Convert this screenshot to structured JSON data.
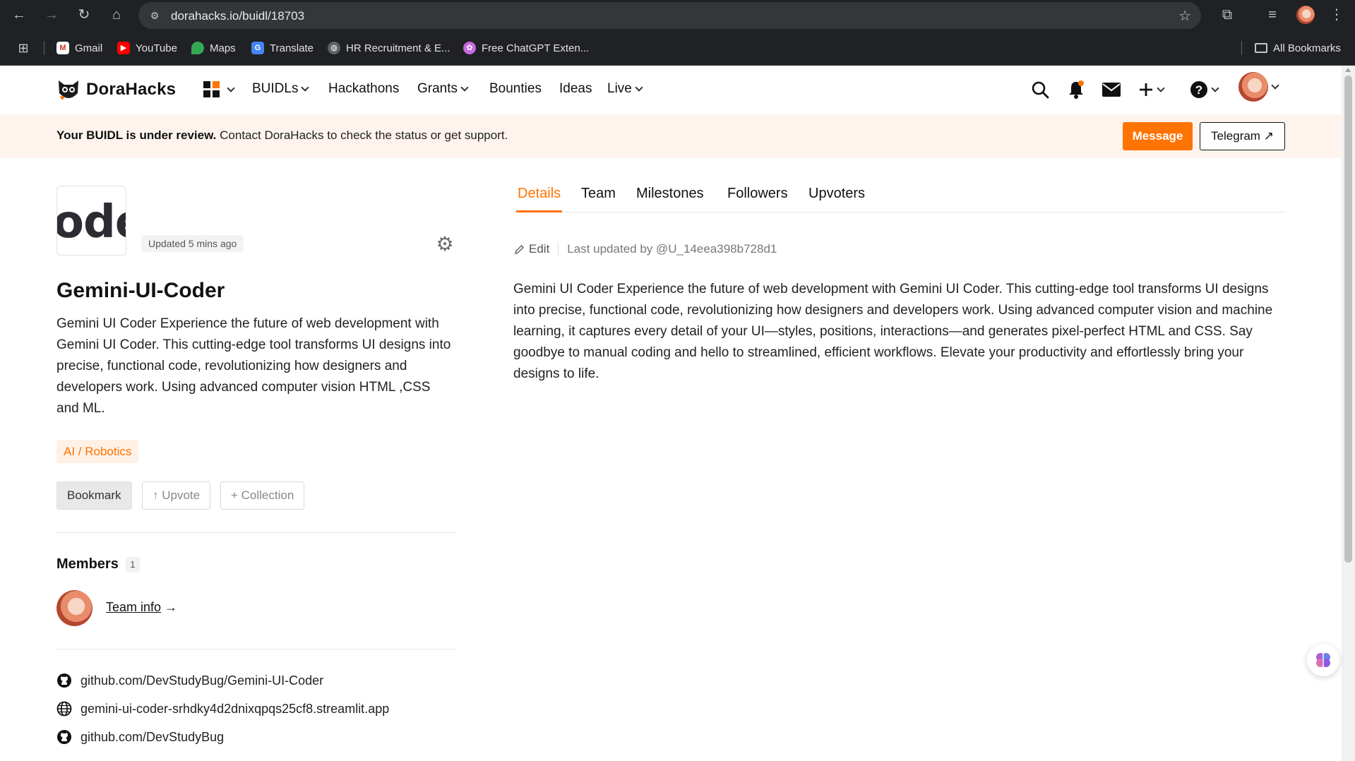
{
  "browser": {
    "url": "dorahacks.io/buidl/18703",
    "bookmarks": [
      {
        "label": "Gmail",
        "icon": "gmail-icon"
      },
      {
        "label": "YouTube",
        "icon": "youtube-icon"
      },
      {
        "label": "Maps",
        "icon": "maps-icon"
      },
      {
        "label": "Translate",
        "icon": "translate-icon"
      },
      {
        "label": "HR Recruitment & E...",
        "icon": "globe-icon"
      },
      {
        "label": "Free ChatGPT Exten...",
        "icon": "brain-icon"
      }
    ],
    "all_bookmarks": "All Bookmarks"
  },
  "nav": {
    "brand": "DoraHacks",
    "items": [
      "BUIDLs",
      "Hackathons",
      "Grants",
      "Bounties",
      "Ideas",
      "Live"
    ]
  },
  "banner": {
    "bold": "Your BUIDL is under review.",
    "text": " Contact DoraHacks to check the status or get support.",
    "message_btn": "Message",
    "telegram_btn": "Telegram ↗"
  },
  "project": {
    "logo_text": "ode",
    "updated": "Updated 5 mins ago",
    "title": "Gemini-UI-Coder",
    "short_desc": "Gemini UI Coder Experience the future of web development with Gemini UI Coder. This cutting-edge tool transforms UI designs into precise, functional code, revolutionizing how designers and developers work. Using advanced computer vision HTML ,CSS and ML.",
    "tag": "AI / Robotics",
    "actions": {
      "bookmark": "Bookmark",
      "upvote": "↑ Upvote",
      "collection": "+ Collection"
    },
    "members_label": "Members",
    "members_count": "1",
    "team_info": "Team info",
    "team_info_arrow": " →",
    "links": [
      {
        "icon": "github-icon",
        "text": "github.com/DevStudyBug/Gemini-UI-Coder"
      },
      {
        "icon": "globe-icon",
        "text": "gemini-ui-coder-srhdky4d2dnixqpqs25cf8.streamlit.app"
      },
      {
        "icon": "github-icon",
        "text": "github.com/DevStudyBug"
      }
    ]
  },
  "tabs": [
    "Details",
    "Team",
    "Milestones",
    "Followers",
    "Upvoters"
  ],
  "details": {
    "edit_label": "Edit",
    "last_updated": "Last updated by @U_14eea398b728d1",
    "body": "Gemini UI Coder Experience the future of web development with Gemini UI Coder. This cutting-edge tool transforms UI designs into precise, functional code, revolutionizing how designers and developers work. Using advanced computer vision and machine learning, it captures every detail of your UI—styles, positions, interactions—and generates pixel-perfect HTML and CSS. Say goodbye to manual coding and hello to streamlined, efficient workflows. Elevate your productivity and effortlessly bring your designs to life."
  },
  "colors": {
    "accent": "#ff7300",
    "banner_bg": "#fff4ed",
    "chrome_bg": "#202124"
  }
}
